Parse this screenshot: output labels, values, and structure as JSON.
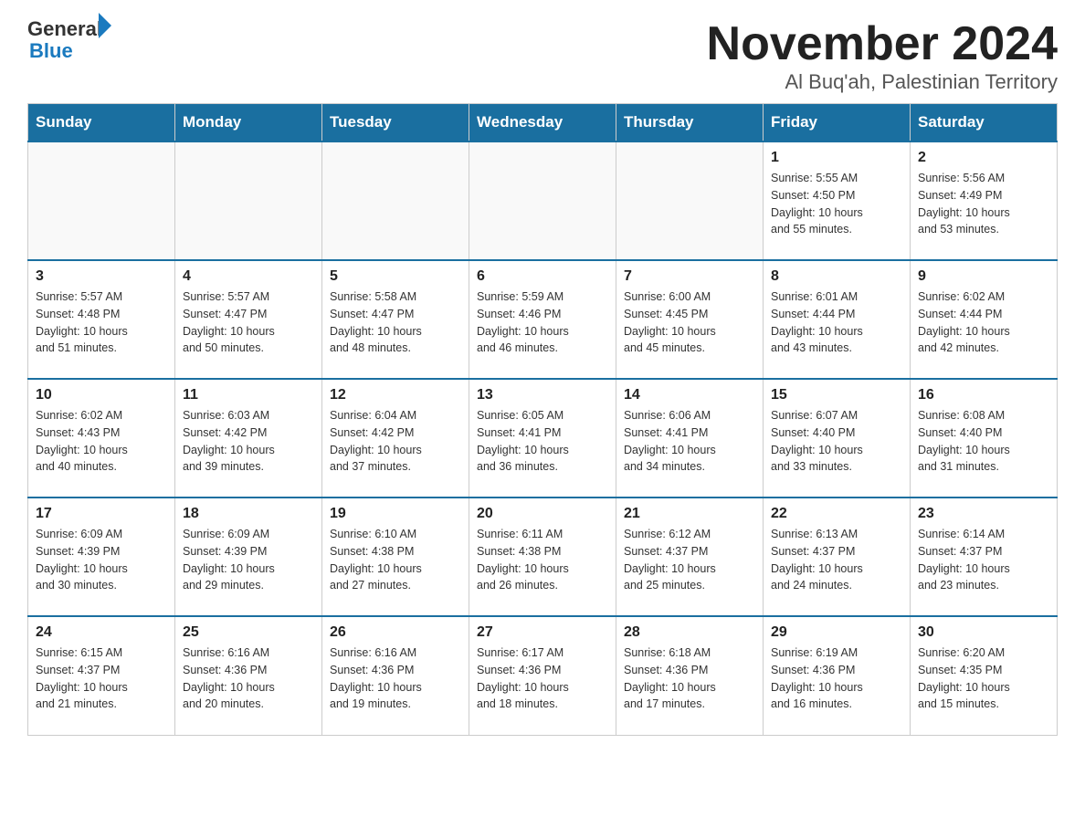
{
  "header": {
    "logo_general": "General",
    "logo_blue": "Blue",
    "month_title": "November 2024",
    "subtitle": "Al Buq'ah, Palestinian Territory"
  },
  "weekdays": [
    "Sunday",
    "Monday",
    "Tuesday",
    "Wednesday",
    "Thursday",
    "Friday",
    "Saturday"
  ],
  "weeks": [
    [
      {
        "day": "",
        "info": ""
      },
      {
        "day": "",
        "info": ""
      },
      {
        "day": "",
        "info": ""
      },
      {
        "day": "",
        "info": ""
      },
      {
        "day": "",
        "info": ""
      },
      {
        "day": "1",
        "info": "Sunrise: 5:55 AM\nSunset: 4:50 PM\nDaylight: 10 hours\nand 55 minutes."
      },
      {
        "day": "2",
        "info": "Sunrise: 5:56 AM\nSunset: 4:49 PM\nDaylight: 10 hours\nand 53 minutes."
      }
    ],
    [
      {
        "day": "3",
        "info": "Sunrise: 5:57 AM\nSunset: 4:48 PM\nDaylight: 10 hours\nand 51 minutes."
      },
      {
        "day": "4",
        "info": "Sunrise: 5:57 AM\nSunset: 4:47 PM\nDaylight: 10 hours\nand 50 minutes."
      },
      {
        "day": "5",
        "info": "Sunrise: 5:58 AM\nSunset: 4:47 PM\nDaylight: 10 hours\nand 48 minutes."
      },
      {
        "day": "6",
        "info": "Sunrise: 5:59 AM\nSunset: 4:46 PM\nDaylight: 10 hours\nand 46 minutes."
      },
      {
        "day": "7",
        "info": "Sunrise: 6:00 AM\nSunset: 4:45 PM\nDaylight: 10 hours\nand 45 minutes."
      },
      {
        "day": "8",
        "info": "Sunrise: 6:01 AM\nSunset: 4:44 PM\nDaylight: 10 hours\nand 43 minutes."
      },
      {
        "day": "9",
        "info": "Sunrise: 6:02 AM\nSunset: 4:44 PM\nDaylight: 10 hours\nand 42 minutes."
      }
    ],
    [
      {
        "day": "10",
        "info": "Sunrise: 6:02 AM\nSunset: 4:43 PM\nDaylight: 10 hours\nand 40 minutes."
      },
      {
        "day": "11",
        "info": "Sunrise: 6:03 AM\nSunset: 4:42 PM\nDaylight: 10 hours\nand 39 minutes."
      },
      {
        "day": "12",
        "info": "Sunrise: 6:04 AM\nSunset: 4:42 PM\nDaylight: 10 hours\nand 37 minutes."
      },
      {
        "day": "13",
        "info": "Sunrise: 6:05 AM\nSunset: 4:41 PM\nDaylight: 10 hours\nand 36 minutes."
      },
      {
        "day": "14",
        "info": "Sunrise: 6:06 AM\nSunset: 4:41 PM\nDaylight: 10 hours\nand 34 minutes."
      },
      {
        "day": "15",
        "info": "Sunrise: 6:07 AM\nSunset: 4:40 PM\nDaylight: 10 hours\nand 33 minutes."
      },
      {
        "day": "16",
        "info": "Sunrise: 6:08 AM\nSunset: 4:40 PM\nDaylight: 10 hours\nand 31 minutes."
      }
    ],
    [
      {
        "day": "17",
        "info": "Sunrise: 6:09 AM\nSunset: 4:39 PM\nDaylight: 10 hours\nand 30 minutes."
      },
      {
        "day": "18",
        "info": "Sunrise: 6:09 AM\nSunset: 4:39 PM\nDaylight: 10 hours\nand 29 minutes."
      },
      {
        "day": "19",
        "info": "Sunrise: 6:10 AM\nSunset: 4:38 PM\nDaylight: 10 hours\nand 27 minutes."
      },
      {
        "day": "20",
        "info": "Sunrise: 6:11 AM\nSunset: 4:38 PM\nDaylight: 10 hours\nand 26 minutes."
      },
      {
        "day": "21",
        "info": "Sunrise: 6:12 AM\nSunset: 4:37 PM\nDaylight: 10 hours\nand 25 minutes."
      },
      {
        "day": "22",
        "info": "Sunrise: 6:13 AM\nSunset: 4:37 PM\nDaylight: 10 hours\nand 24 minutes."
      },
      {
        "day": "23",
        "info": "Sunrise: 6:14 AM\nSunset: 4:37 PM\nDaylight: 10 hours\nand 23 minutes."
      }
    ],
    [
      {
        "day": "24",
        "info": "Sunrise: 6:15 AM\nSunset: 4:37 PM\nDaylight: 10 hours\nand 21 minutes."
      },
      {
        "day": "25",
        "info": "Sunrise: 6:16 AM\nSunset: 4:36 PM\nDaylight: 10 hours\nand 20 minutes."
      },
      {
        "day": "26",
        "info": "Sunrise: 6:16 AM\nSunset: 4:36 PM\nDaylight: 10 hours\nand 19 minutes."
      },
      {
        "day": "27",
        "info": "Sunrise: 6:17 AM\nSunset: 4:36 PM\nDaylight: 10 hours\nand 18 minutes."
      },
      {
        "day": "28",
        "info": "Sunrise: 6:18 AM\nSunset: 4:36 PM\nDaylight: 10 hours\nand 17 minutes."
      },
      {
        "day": "29",
        "info": "Sunrise: 6:19 AM\nSunset: 4:36 PM\nDaylight: 10 hours\nand 16 minutes."
      },
      {
        "day": "30",
        "info": "Sunrise: 6:20 AM\nSunset: 4:35 PM\nDaylight: 10 hours\nand 15 minutes."
      }
    ]
  ]
}
